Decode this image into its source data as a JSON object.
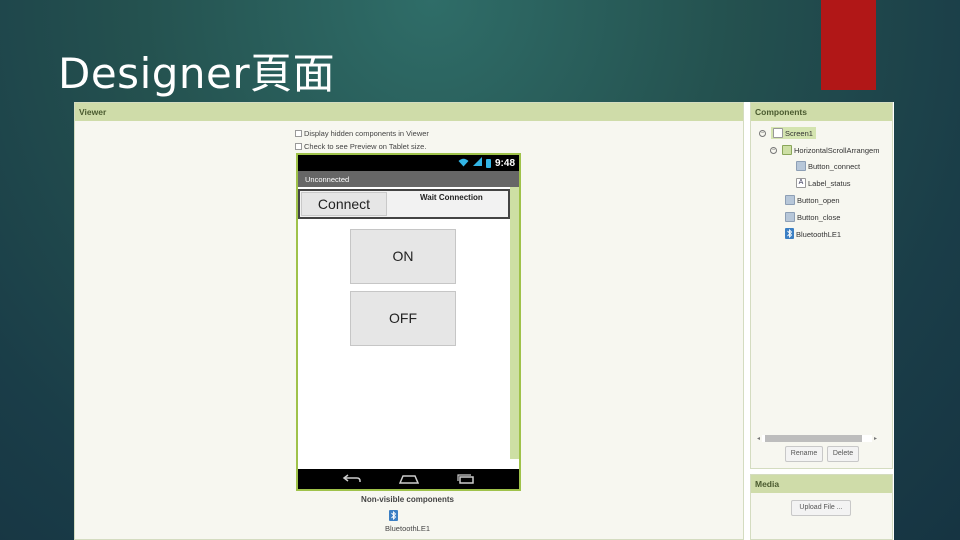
{
  "slide": {
    "title": "Designer頁面"
  },
  "colors": {
    "accent_red": "#b11717",
    "panel_header": "#cfdca9",
    "phone_border": "#9fc24a"
  },
  "viewer": {
    "header": "Viewer",
    "option_hidden": "Display hidden components in Viewer",
    "option_tablet": "Check to see Preview on Tablet size.",
    "phone": {
      "time": "9:48",
      "title": "Unconnected",
      "connect_button": "Connect",
      "status_label": "Wait Connection",
      "on_button": "ON",
      "off_button": "OFF"
    },
    "nonvisible_title": "Non-visible components",
    "nonvisible_item": "BluetoothLE1"
  },
  "components": {
    "header": "Components",
    "tree": [
      {
        "label": "Screen1",
        "icon": "screen-icon"
      },
      {
        "label": "HorizontalScrollArrangem",
        "icon": "arrangement-icon"
      },
      {
        "label": "Button_connect",
        "icon": "button-icon"
      },
      {
        "label": "Label_status",
        "icon": "label-icon"
      },
      {
        "label": "Button_open",
        "icon": "button-icon"
      },
      {
        "label": "Button_close",
        "icon": "button-icon"
      },
      {
        "label": "BluetoothLE1",
        "icon": "bluetooth-icon"
      }
    ],
    "rename_button": "Rename",
    "delete_button": "Delete"
  },
  "media": {
    "header": "Media",
    "upload_button": "Upload File ..."
  }
}
